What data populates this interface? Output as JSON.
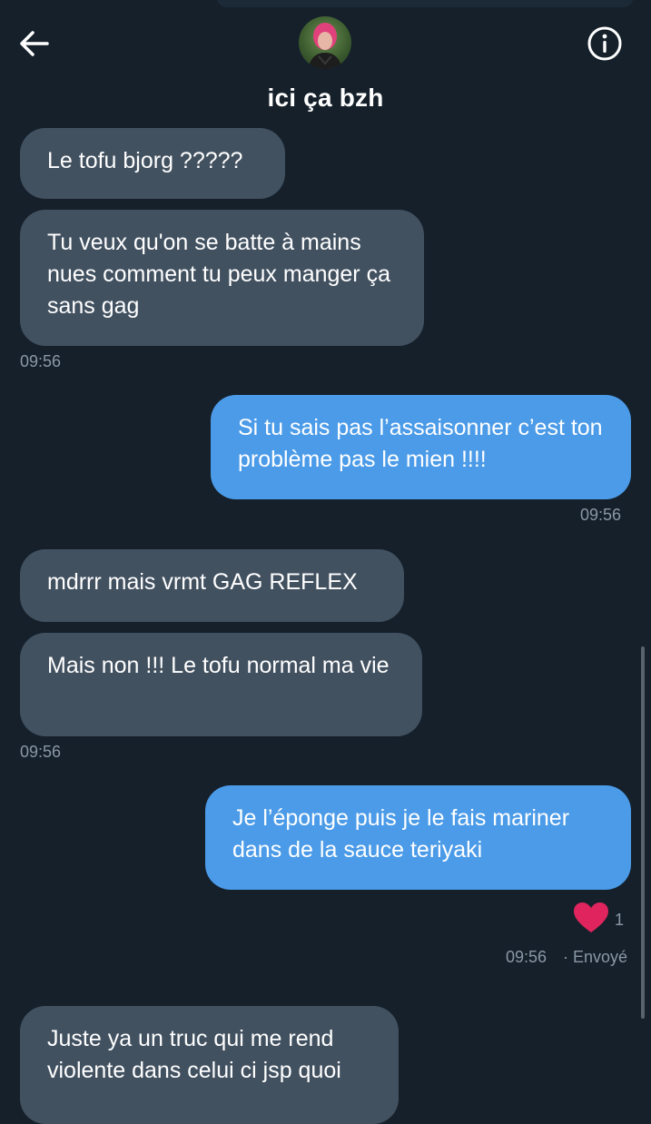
{
  "header": {
    "title": "ici ça bzh",
    "back_icon": "arrow-left-icon",
    "info_icon": "info-icon"
  },
  "messages": [
    {
      "from": "them",
      "text": "Le tofu bjorg ?????"
    },
    {
      "from": "them",
      "text": "Tu veux qu'on se batte à mains nues comment tu peux manger ça sans gag"
    },
    {
      "from": "them",
      "time": "09:56"
    },
    {
      "from": "me",
      "text": "Si tu sais pas l’assaisonner c’est ton problème pas le mien !!!!"
    },
    {
      "from": "me",
      "time": "09:56"
    },
    {
      "from": "them",
      "text": "mdrrr mais vrmt GAG REFLEX"
    },
    {
      "from": "them",
      "text": "Mais non !!! Le tofu normal ma vie"
    },
    {
      "from": "them",
      "time": "09:56"
    },
    {
      "from": "me",
      "text": "Je l’éponge puis je le fais mariner dans de la sauce teriyaki"
    },
    {
      "from": "them",
      "text": "Juste ya un truc qui me rend violente dans celui ci jsp quoi"
    }
  ],
  "reaction": {
    "icon": "heart-icon",
    "count": "1",
    "color": "#e0245e"
  },
  "status": {
    "time": "09:56",
    "sent_label": "· Envoyé"
  },
  "colors": {
    "background": "#15202b",
    "received_bubble": "#425160",
    "sent_bubble": "#4b9be8",
    "muted_text": "#8b98a5"
  }
}
